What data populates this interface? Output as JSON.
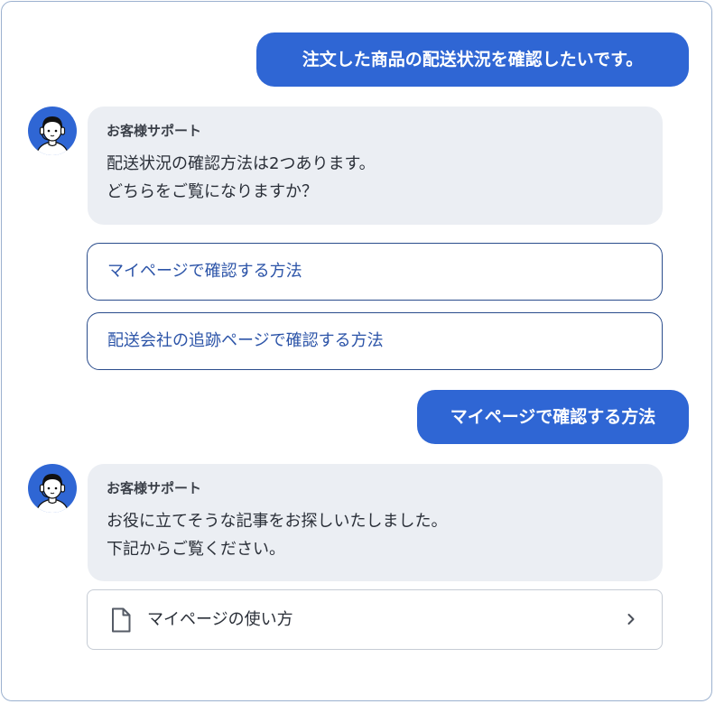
{
  "messages": {
    "user_1": "注文した商品の配送状況を確認したいです。",
    "bot_1": {
      "sender": "お客様サポート",
      "lines": [
        "配送状況の確認方法は2つあります。",
        "どちらをご覧になりますか？"
      ]
    },
    "options": [
      "マイページで確認する方法",
      "配送会社の追跡ページで確認する方法"
    ],
    "user_2": "マイページで確認する方法",
    "bot_2": {
      "sender": "お客様サポート",
      "lines": [
        "お役に立てそうな記事をお探しいたしました。",
        "下記からご覧ください。"
      ]
    },
    "article": {
      "label": "マイページの使い方",
      "icon": "document-icon",
      "action_icon": "chevron-right-icon"
    }
  },
  "colors": {
    "user_bubble": "#2f66d4",
    "bot_bubble": "#ebeef3",
    "option_border": "#2a4c8c",
    "avatar_bg": "#2f66d4"
  }
}
